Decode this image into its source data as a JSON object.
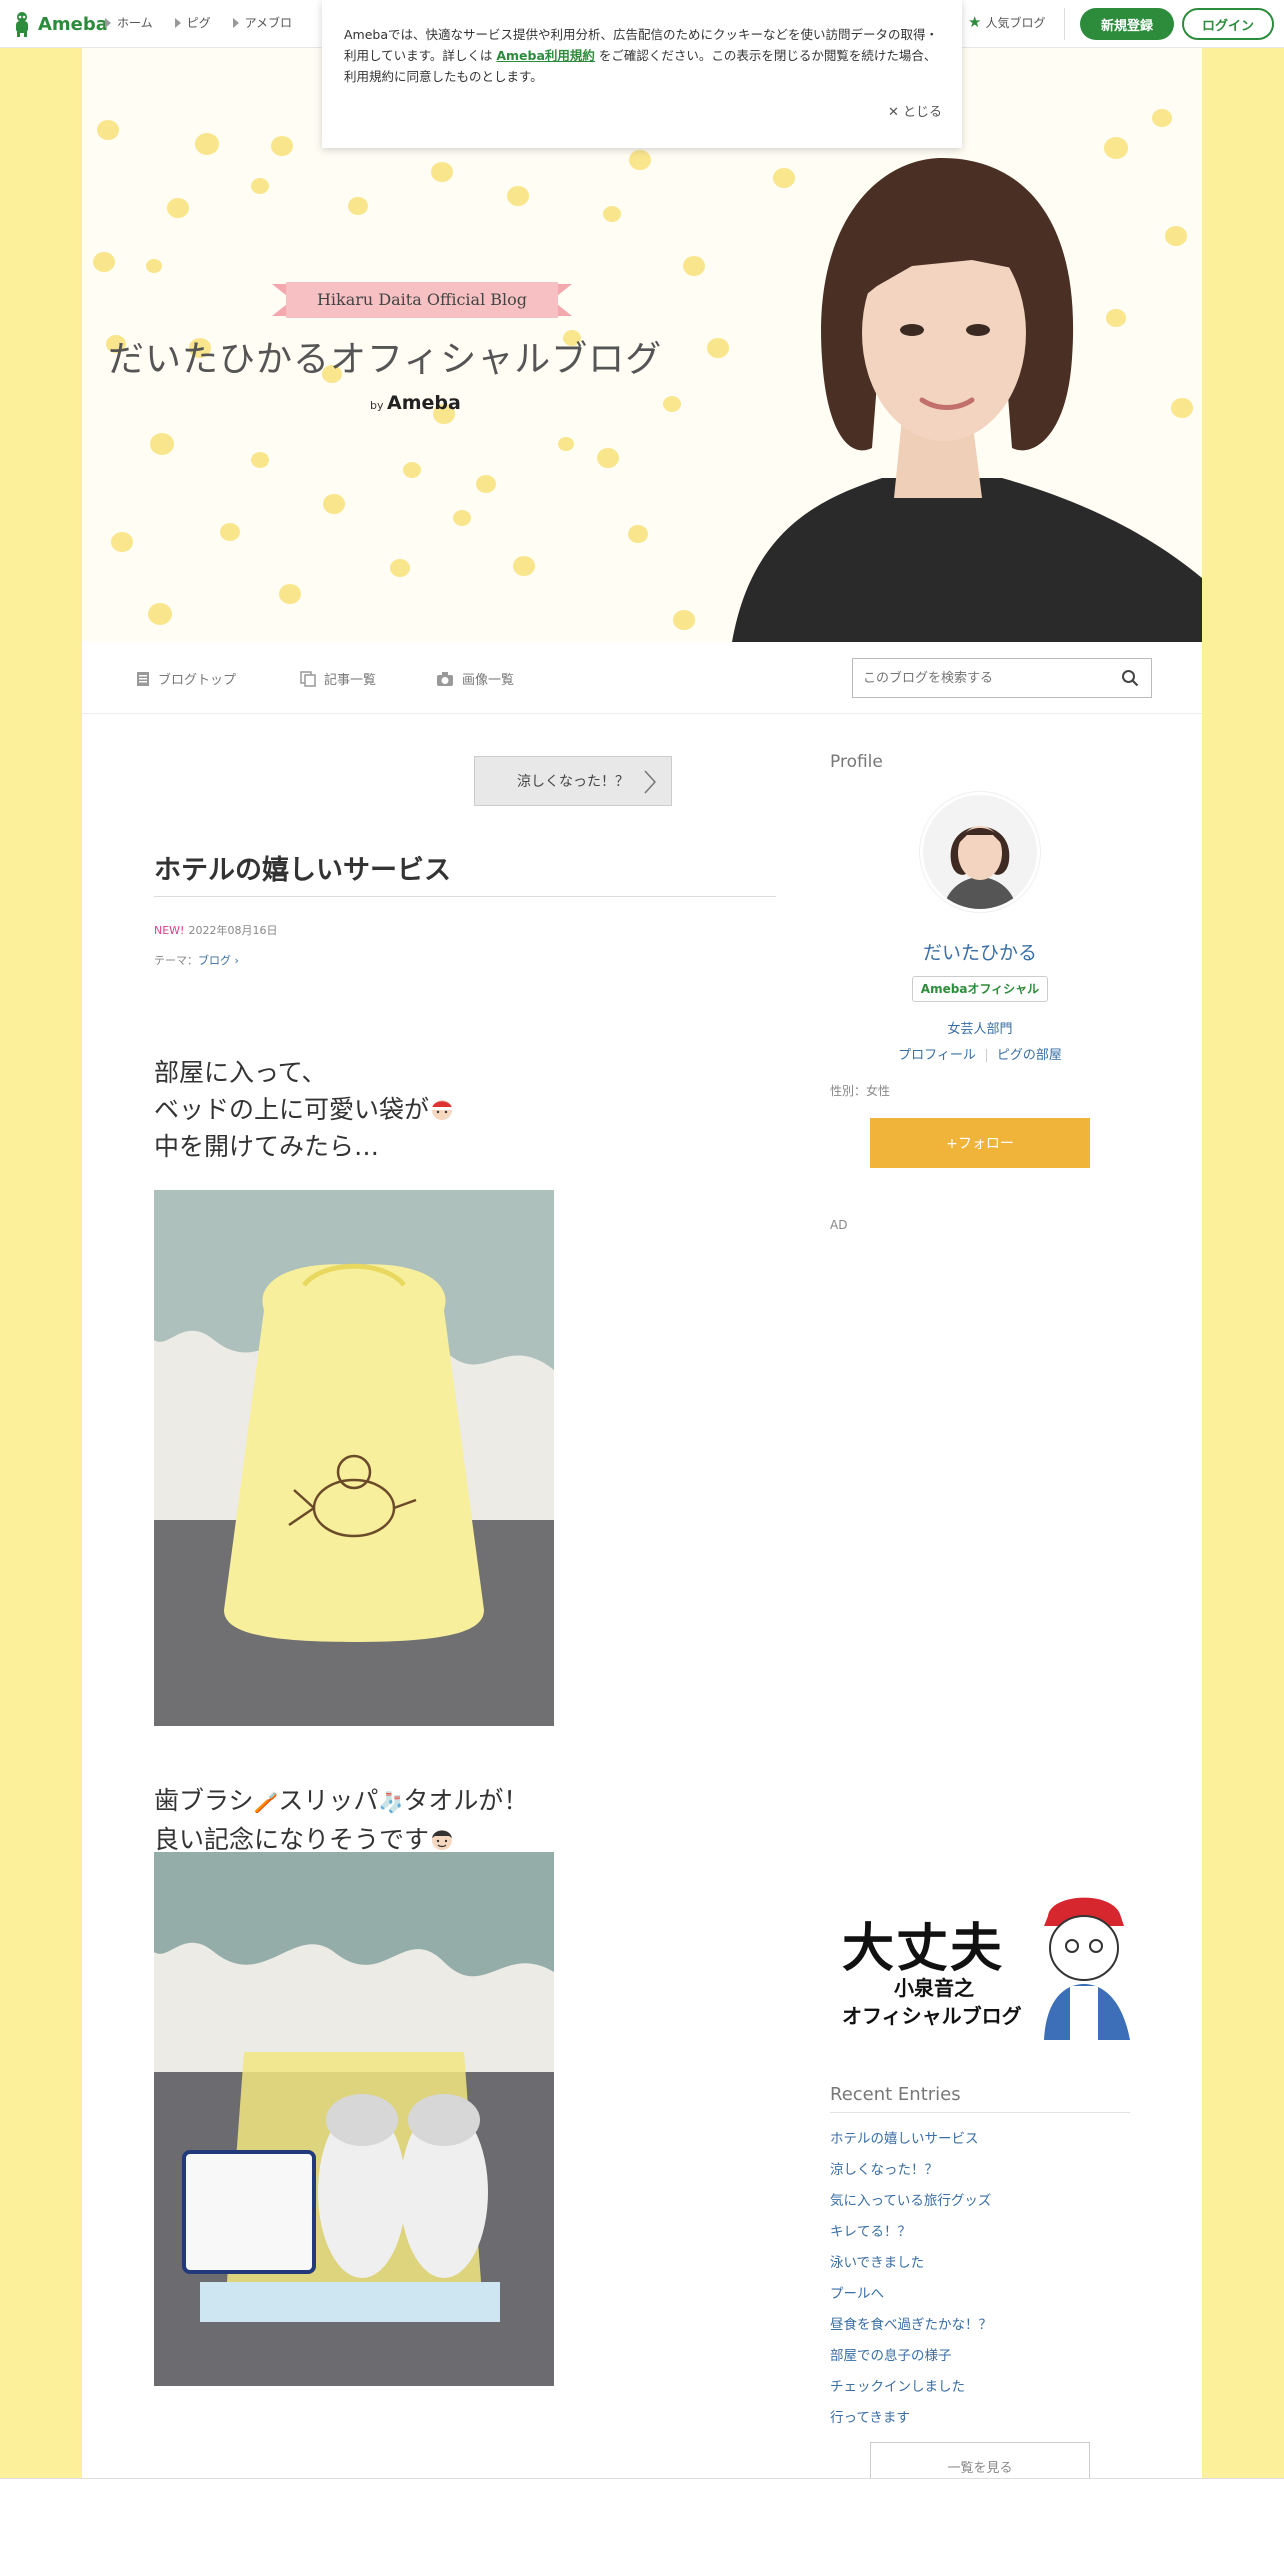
{
  "topbar": {
    "logo": "Ameba",
    "nav": [
      "ホーム",
      "ピグ",
      "アメブロ"
    ],
    "popular": "人気ブログ",
    "signup": "新規登録",
    "login": "ログイン"
  },
  "cookie": {
    "text1": "Amebaでは、快適なサービス提供や利用分析、広告配信のためにクッキーなどを使い訪問データの取得・利用しています。詳しくは ",
    "link": "Ameba利用規約",
    "text2": " をご確認ください。この表示を閉じるか閲覧を続けた場合、利用規約に同意したものとします。",
    "close": "とじる"
  },
  "header": {
    "ribbon": "Hikaru Daita Official Blog",
    "title": "だいたひかるオフィシャルブログ",
    "by": "by",
    "ameba": "Ameba"
  },
  "subnav": {
    "top": "ブログトップ",
    "list": "記事一覧",
    "images": "画像一覧",
    "search_placeholder": "このブログを検索する"
  },
  "article": {
    "prev": "涼しくなった！？",
    "title": "ホテルの嬉しいサービス",
    "new": "NEW!",
    "date": "2022年08月16日",
    "theme_label": "テーマ：",
    "theme": "ブログ",
    "para1": [
      "部屋に入って、",
      "ベッドの上に可愛い袋が",
      "中を開けてみたら…"
    ],
    "para2": [
      "歯ブラシ",
      "スリッパ",
      "タオルが！",
      "良い記念になりそうです"
    ]
  },
  "sidebar": {
    "profile_heading": "Profile",
    "name": "だいたひかる",
    "badge": "Amebaオフィシャル",
    "genre": "女芸人部門",
    "profile_link": "プロフィール",
    "pigg_link": "ピグの部屋",
    "gender": "性別：女性",
    "follow": "+フォロー",
    "ad": "AD",
    "banner": {
      "line1": "大丈夫",
      "line2": "小泉音之",
      "line3": "オフィシャルブログ"
    },
    "recent_heading": "Recent Entries",
    "recent": [
      "ホテルの嬉しいサービス",
      "涼しくなった！？",
      "気に入っている旅行グッズ",
      "キレてる！？",
      "泳いできました",
      "プールへ",
      "昼食を食べ過ぎたかな！？",
      "部屋での息子の様子",
      "チェックインしました",
      "行ってきます"
    ],
    "see_all": "一覧を見る"
  },
  "colors": {
    "ameba_green": "#2d8c3c",
    "link_blue": "#3a6ea5",
    "follow_orange": "#f0b43a",
    "background_yellow": "#fdf09b",
    "new_pink": "#e0418c"
  }
}
